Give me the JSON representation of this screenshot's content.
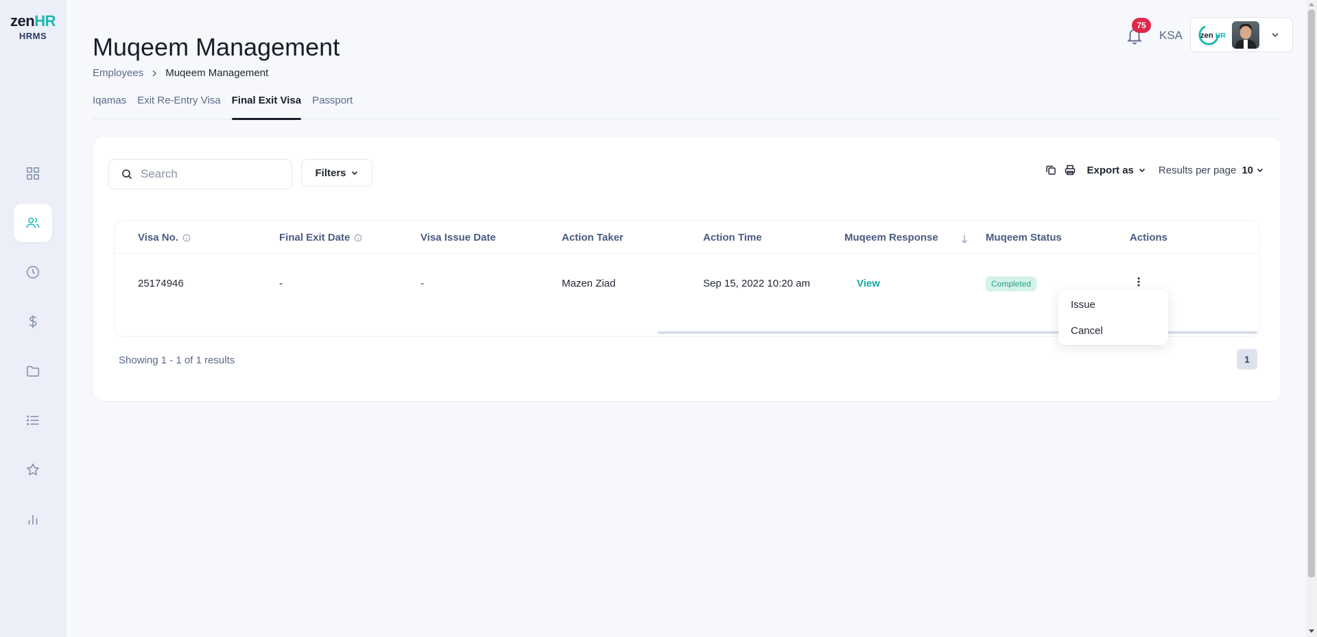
{
  "brand": {
    "logo_main": "zen",
    "logo_accent": "HR",
    "logo_sub": "HRMS",
    "accent_color": "#19b8b0"
  },
  "sidebar": {
    "items": [
      {
        "icon": "dashboard-grid-icon"
      },
      {
        "icon": "users-icon",
        "active": true
      },
      {
        "icon": "clock-icon"
      },
      {
        "icon": "dollar-icon"
      },
      {
        "icon": "folder-icon"
      },
      {
        "icon": "list-icon"
      },
      {
        "icon": "star-icon"
      },
      {
        "icon": "bar-chart-icon"
      }
    ]
  },
  "header": {
    "title": "Muqeem Management",
    "breadcrumb": {
      "parent": "Employees",
      "current": "Muqeem Management"
    },
    "notifications_count": "75",
    "region": "KSA",
    "account_logo": "zenHR"
  },
  "tabs": [
    {
      "label": "Iqamas",
      "active": false
    },
    {
      "label": "Exit Re-Entry Visa",
      "active": false
    },
    {
      "label": "Final Exit Visa",
      "active": true
    },
    {
      "label": "Passport",
      "active": false
    }
  ],
  "toolbar": {
    "search_placeholder": "Search",
    "filters_label": "Filters",
    "export_label": "Export as",
    "results_per_page_label": "Results per page",
    "results_per_page_value": "10"
  },
  "table": {
    "columns": [
      "Visa No.",
      "Final Exit Date",
      "Visa Issue Date",
      "Action Taker",
      "Action Time",
      "Muqeem Response",
      "Muqeem Status",
      "Actions"
    ],
    "rows": [
      {
        "visa_no": "25174946",
        "final_exit_date": "-",
        "visa_issue_date": "-",
        "action_taker": "Mazen Ziad",
        "action_time": "Sep 15, 2022 10:20 am",
        "muqeem_response": "View",
        "muqeem_status": "Completed"
      }
    ]
  },
  "footer": {
    "showing": "Showing 1 - 1 of 1 results",
    "current_page": "1"
  },
  "actions_menu": {
    "items": [
      "Issue",
      "Cancel"
    ]
  },
  "colors": {
    "status_bg": "#d4f3ea",
    "status_text": "#27a07e",
    "badge": "#e0284a",
    "link": "#17a89f"
  }
}
